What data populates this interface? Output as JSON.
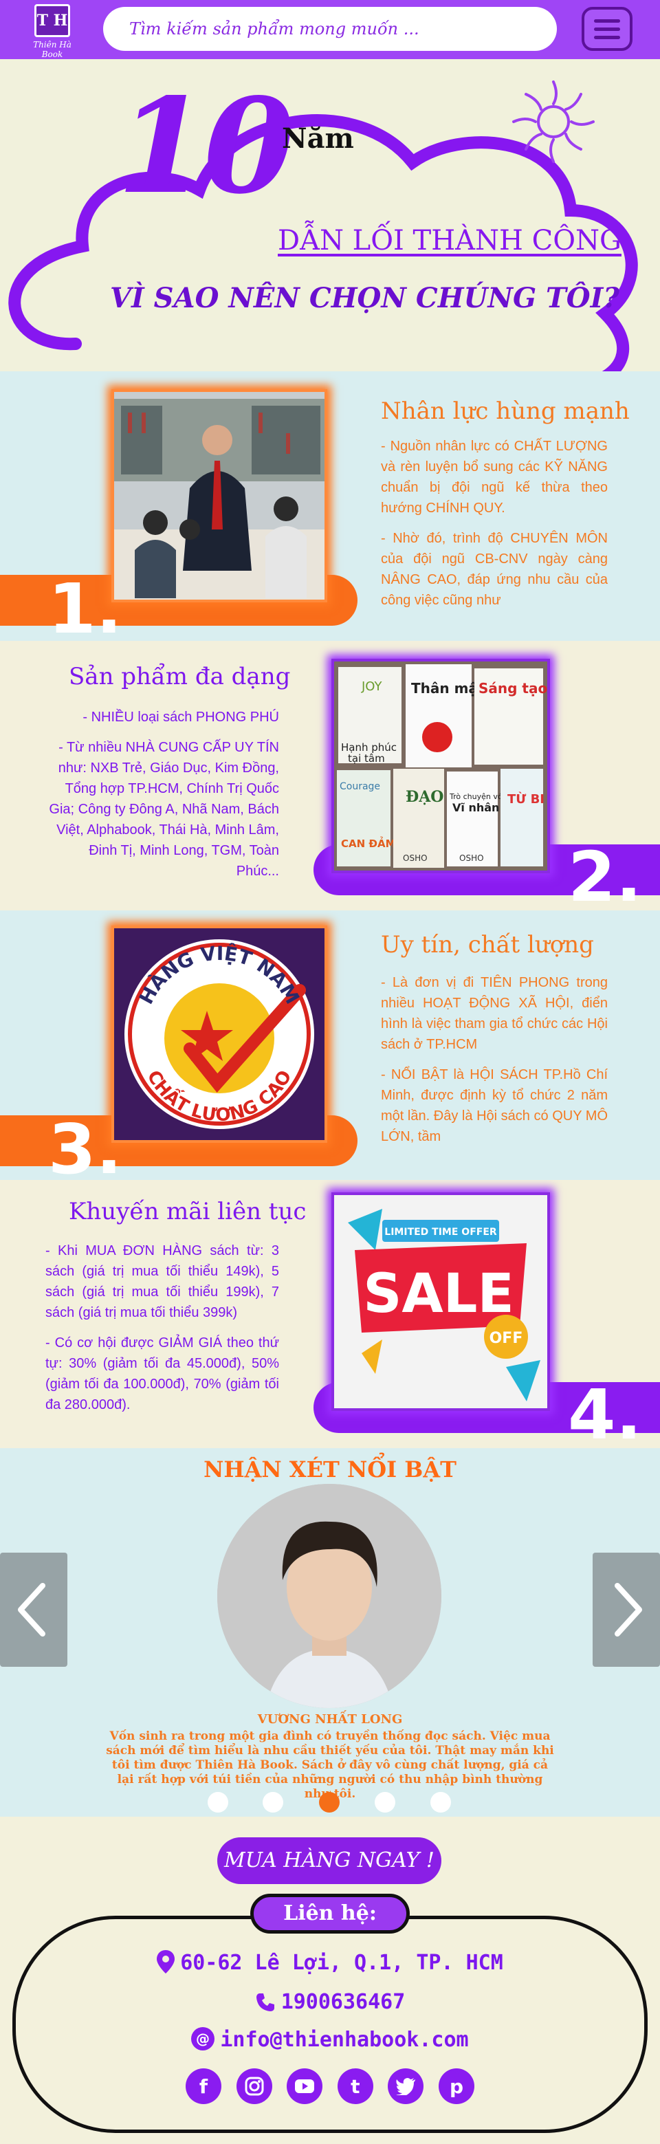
{
  "header": {
    "logo_initials": "T H",
    "logo_name": "Thiên Hà Book",
    "search_placeholder": "Tìm kiếm sản phẩm mong muốn ..."
  },
  "hero": {
    "big_number": "10",
    "nam": "Năm",
    "tagline": "DẪN LỐI THÀNH CÔNG",
    "question": "VÌ SAO NÊN CHỌN CHÚNG TÔI?"
  },
  "sections": [
    {
      "number": "1.",
      "title": "Nhân lực hùng mạnh",
      "paragraphs": [
        "- Nguồn nhân lực có CHẤT LƯỢNG và rèn luyện bổ sung các KỸ NĂNG chuẩn bị đội ngũ kế thừa theo hướng CHÍNH QUY.",
        "- Nhờ đó, trình độ CHUYÊN MÔN của đội ngũ CB-CNV ngày càng NÂNG CAO, đáp ứng nhu cầu của công việc cũng như"
      ]
    },
    {
      "number": "2.",
      "title": "Sản phẩm đa dạng",
      "paragraphs": [
        "- NHIỀU loại sách PHONG PHÚ",
        "- Từ nhiều NHÀ CUNG CẤP UY TÍN như: NXB Trẻ, Giáo Dục, Kim Đồng, Tổng hợp TP.HCM, Chính Trị Quốc Gia; Công ty Đông A, Nhã Nam, Bách Việt, Alphabook, Thái Hà, Minh Lâm, Đinh Tị, Minh Long, TGM, Toàn Phúc..."
      ],
      "book_titles": [
        "JOY",
        "Thân mật",
        "Sáng tạo",
        "Hạnh phúc tại tâm",
        "Courage CAN ĐẢM",
        "ĐẠO",
        "Trò chuyện với Vĩ nhân",
        "TỪ BI",
        "OSHO"
      ]
    },
    {
      "number": "3.",
      "title": "Uy tín, chất lượng",
      "paragraphs": [
        "- Là đơn vị đi TIÊN PHONG trong nhiều HOẠT ĐỘNG XÃ HỘI, điển hình là việc tham gia tổ chức các Hội sách ở TP.HCM",
        "- NỔI BẬT là HỘI SÁCH TP.Hồ Chí Minh, được định kỳ tổ chức 2 năm một lần. Đây là Hội sách có QUY MÔ LỚN, tầm"
      ],
      "badge_top": "HÀNG VIỆT NAM",
      "badge_bottom": "CHẤT LƯỢNG CAO"
    },
    {
      "number": "4.",
      "title": "Khuyến mãi liên tục",
      "paragraphs": [
        "- Khi MUA ĐƠN HÀNG sách từ: 3 sách (giá trị mua tối thiểu 149k), 5 sách (giá trị mua tối thiểu 199k), 7 sách (giá trị mua tối thiểu 399k)",
        "- Có cơ hội được GIẢM GIÁ theo thứ tự: 30% (giảm tối đa 45.000đ), 50% (giảm tối đa 100.000đ), 70% (giảm tối đa 280.000đ)."
      ],
      "sale_banner": "LIMITED TIME OFFER",
      "sale_word": "SALE",
      "sale_off": "OFF"
    }
  ],
  "reviews": {
    "title": "NHẬN XÉT NỔI BẬT",
    "name": "VƯƠNG NHẤT LONG",
    "text": "Vốn sinh ra trong một gia đình có truyền thống đọc sách. Việc mua sách mới để tìm hiểu là nhu cầu thiết yếu của tôi. Thật may mắn khi tôi tìm được Thiên Hà Book. Sách ở đây vô cùng chất lượng, giá cả lại rất hợp với túi tiền của những người có thu nhập bình thường như tôi.",
    "prev_icon": "chevron-left-icon",
    "next_icon": "chevron-right-icon",
    "active_dot": 2,
    "dot_count": 5
  },
  "cta": {
    "label": "MUA HÀNG NGAY !"
  },
  "contact": {
    "label": "Liên hệ:",
    "address": "60-62 Lê Lợi, Q.1, TP. HCM",
    "phone": "1900636467",
    "email": "info@thienhabook.com"
  },
  "colors": {
    "purple": "#8617f0",
    "orange": "#f47a22",
    "header": "#9f45f5",
    "blue_bg": "#d9eef0",
    "cream_bg": "#f3f0dc"
  },
  "socials": [
    "facebook-icon",
    "instagram-icon",
    "youtube-icon",
    "tumblr-icon",
    "twitter-icon",
    "pinterest-icon"
  ]
}
